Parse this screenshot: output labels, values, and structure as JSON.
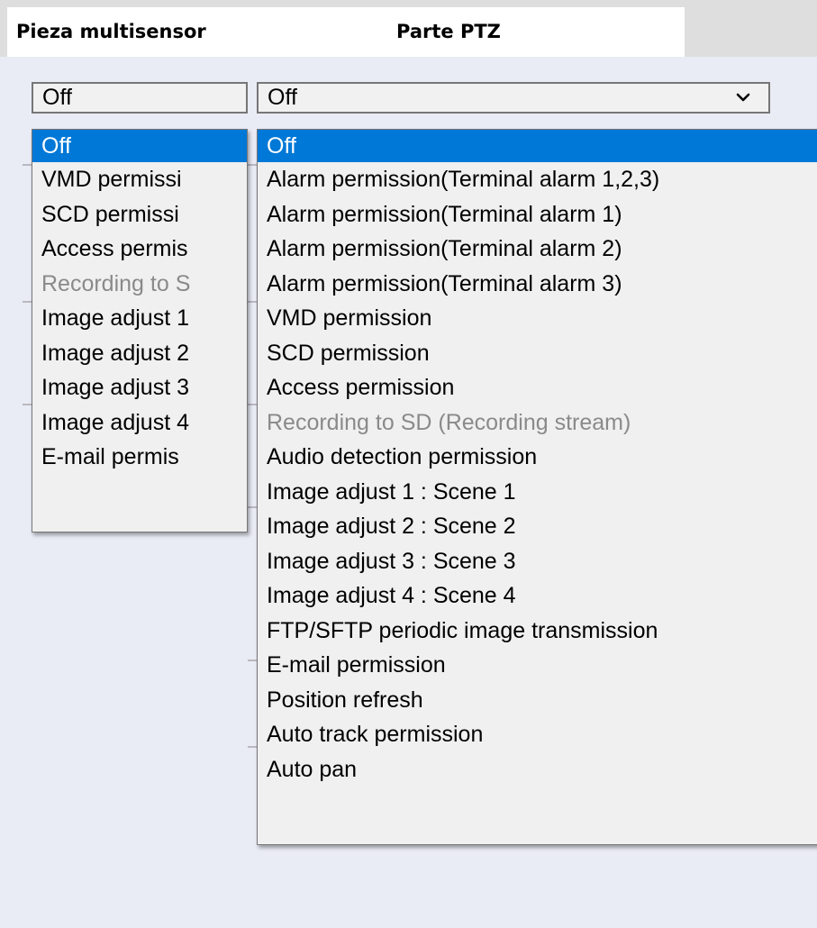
{
  "headers": {
    "left": "Pieza multisensor",
    "right": "Parte PTZ"
  },
  "left_dropdown": {
    "value": "Off",
    "options": [
      {
        "label": "Off",
        "selected": true,
        "disabled": false
      },
      {
        "label": "VMD permissi",
        "selected": false,
        "disabled": false
      },
      {
        "label": "SCD permissi",
        "selected": false,
        "disabled": false
      },
      {
        "label": "Access permis",
        "selected": false,
        "disabled": false
      },
      {
        "label": "Recording to S",
        "selected": false,
        "disabled": true
      },
      {
        "label": "Image adjust 1",
        "selected": false,
        "disabled": false
      },
      {
        "label": "Image adjust 2",
        "selected": false,
        "disabled": false
      },
      {
        "label": "Image adjust 3",
        "selected": false,
        "disabled": false
      },
      {
        "label": "Image adjust 4",
        "selected": false,
        "disabled": false
      },
      {
        "label": "E-mail permis",
        "selected": false,
        "disabled": false
      }
    ]
  },
  "right_dropdown": {
    "value": "Off",
    "options": [
      {
        "label": "Off",
        "selected": true,
        "disabled": false
      },
      {
        "label": "Alarm permission(Terminal alarm 1,2,3)",
        "selected": false,
        "disabled": false
      },
      {
        "label": "Alarm permission(Terminal alarm 1)",
        "selected": false,
        "disabled": false
      },
      {
        "label": "Alarm permission(Terminal alarm 2)",
        "selected": false,
        "disabled": false
      },
      {
        "label": "Alarm permission(Terminal alarm 3)",
        "selected": false,
        "disabled": false
      },
      {
        "label": "VMD permission",
        "selected": false,
        "disabled": false
      },
      {
        "label": "SCD permission",
        "selected": false,
        "disabled": false
      },
      {
        "label": "Access permission",
        "selected": false,
        "disabled": false
      },
      {
        "label": "Recording to SD (Recording stream)",
        "selected": false,
        "disabled": true
      },
      {
        "label": "Audio detection permission",
        "selected": false,
        "disabled": false
      },
      {
        "label": "Image adjust 1 : Scene 1",
        "selected": false,
        "disabled": false
      },
      {
        "label": "Image adjust 2 : Scene 2",
        "selected": false,
        "disabled": false
      },
      {
        "label": "Image adjust 3 : Scene 3",
        "selected": false,
        "disabled": false
      },
      {
        "label": "Image adjust 4 : Scene 4",
        "selected": false,
        "disabled": false
      },
      {
        "label": "FTP/SFTP periodic image transmission",
        "selected": false,
        "disabled": false
      },
      {
        "label": "E-mail permission",
        "selected": false,
        "disabled": false
      },
      {
        "label": "Position refresh",
        "selected": false,
        "disabled": false
      },
      {
        "label": "Auto track permission",
        "selected": false,
        "disabled": false
      },
      {
        "label": "Auto pan",
        "selected": false,
        "disabled": false
      }
    ]
  },
  "icons": {
    "dropdown_arrow": "chevron-down-icon"
  },
  "colors": {
    "selection": "#0078d7",
    "disabled_text": "#8a8a8a",
    "page_background": "#e9ebf5"
  }
}
